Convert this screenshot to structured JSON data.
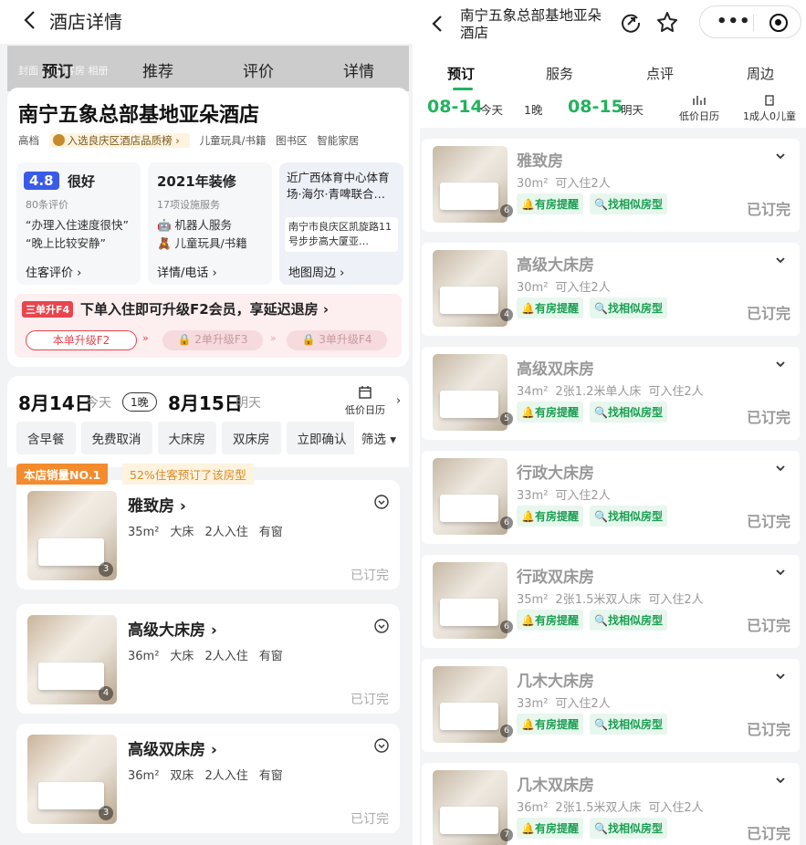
{
  "left": {
    "title": "酒店详情",
    "ghost_tabs": "封面 酒店 客房 相册",
    "tabs": [
      "预订",
      "推荐",
      "评价",
      "详情"
    ],
    "hotel_name": "南宁五象总部基地亚朵酒店",
    "tags": {
      "grade": "高档",
      "rank": "入选良庆区酒店品质榜 ›",
      "t1": "儿童玩具/书籍",
      "t2": "图书区",
      "t3": "智能家居"
    },
    "score": {
      "value": "4.8",
      "label": "很好",
      "count": "80条评价",
      "q1": "“办理入住速度很快”",
      "q2": "“晚上比较安静”",
      "link": "住客评价 ›"
    },
    "facility": {
      "year": "2021年装修",
      "count": "17项设施服务",
      "f1": "机器人服务",
      "f2": "儿童玩具/书籍",
      "link": "详情/电话 ›"
    },
    "location": {
      "near": "近广西体育中心体育场·海尔·青啤联合…",
      "address": "南宁市良庆区凯旋路11号步步高大厦亚…",
      "link": "地图周边 ›"
    },
    "promo": {
      "badge": "三单升F4",
      "text": "下单入住即可升级F2会员，享延迟退房 ›",
      "s1": "本单升级F2",
      "s2": "2单升级F3",
      "s3": "3单升级F4"
    },
    "dates": {
      "checkin": "8月14日",
      "checkin_sub": "今天",
      "nights": "1晚",
      "checkout": "8月15日",
      "checkout_sub": "明天",
      "calendar": "低价日历"
    },
    "chips": [
      "含早餐",
      "免费取消",
      "大床房",
      "双床房",
      "立即确认"
    ],
    "filter": "筛选 ▾",
    "hot": "本店销量NO.1",
    "hot_pct": "52%住客预订了该房型",
    "rooms": [
      {
        "name": "雅致房 ›",
        "area": "35m²",
        "bed": "大床",
        "guests": "2人入住",
        "window": "有窗",
        "photos": "3",
        "status": "已订完"
      },
      {
        "name": "高级大床房 ›",
        "area": "36m²",
        "bed": "大床",
        "guests": "2人入住",
        "window": "有窗",
        "photos": "4",
        "status": "已订完"
      },
      {
        "name": "高级双床房 ›",
        "area": "36m²",
        "bed": "双床",
        "guests": "2人入住",
        "window": "有窗",
        "photos": "3",
        "status": "已订完"
      }
    ]
  },
  "right": {
    "title": "南宁五象总部基地亚朵酒店",
    "tabs": [
      "预订",
      "服务",
      "点评",
      "周边"
    ],
    "dates": {
      "checkin": "08-14",
      "checkin_sub": "今天",
      "nights": "1晚",
      "checkout": "08-15",
      "checkout_sub": "明天",
      "calendar": "低价日历",
      "guests": "1成人0儿童"
    },
    "tag_notify": "有房提醒",
    "tag_similar": "找相似房型",
    "sold": "已订完",
    "rooms": [
      {
        "name": "雅致房",
        "area": "30m²",
        "bed": "",
        "guests": "可入住2人",
        "photos": "6"
      },
      {
        "name": "高级大床房",
        "area": "30m²",
        "bed": "",
        "guests": "可入住2人",
        "photos": "4"
      },
      {
        "name": "高级双床房",
        "area": "34m²",
        "bed": "2张1.2米单人床",
        "guests": "可入住2人",
        "photos": "5"
      },
      {
        "name": "行政大床房",
        "area": "33m²",
        "bed": "",
        "guests": "可入住2人",
        "photos": "6"
      },
      {
        "name": "行政双床房",
        "area": "35m²",
        "bed": "2张1.5米双人床",
        "guests": "可入住2人",
        "photos": "6"
      },
      {
        "name": "几木大床房",
        "area": "33m²",
        "bed": "",
        "guests": "可入住2人",
        "photos": "6"
      },
      {
        "name": "几木双床房",
        "area": "36m²",
        "bed": "2张1.5米双人床",
        "guests": "可入住2人",
        "photos": "7"
      }
    ]
  }
}
